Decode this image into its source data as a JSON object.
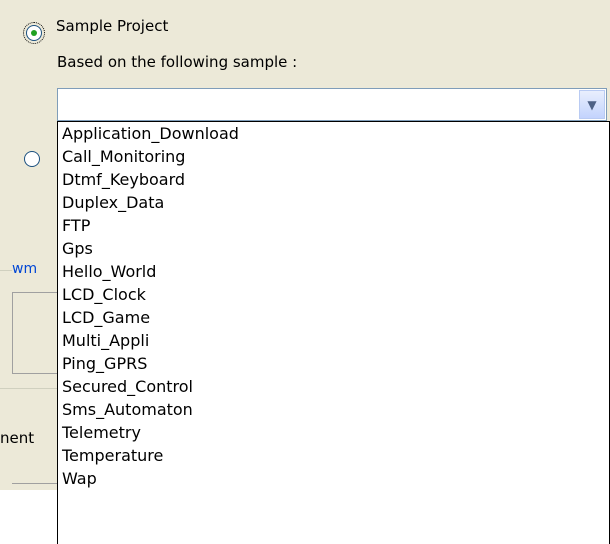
{
  "sample_project": {
    "radio_label": "Sample Project",
    "based_on_label": "Based on the following sample :",
    "combo_value": "",
    "dropdown_arrow_icon": "chevron-down-icon"
  },
  "group_frame": {
    "label": "wm"
  },
  "partial_label": "nent",
  "sample_list": [
    "Application_Download",
    "Call_Monitoring",
    "Dtmf_Keyboard",
    "Duplex_Data",
    "FTP",
    "Gps",
    "Hello_World",
    "LCD_Clock",
    "LCD_Game",
    "Multi_Appli",
    "Ping_GPRS",
    "Secured_Control",
    "Sms_Automaton",
    "Telemetry",
    "Temperature",
    "Wap"
  ]
}
